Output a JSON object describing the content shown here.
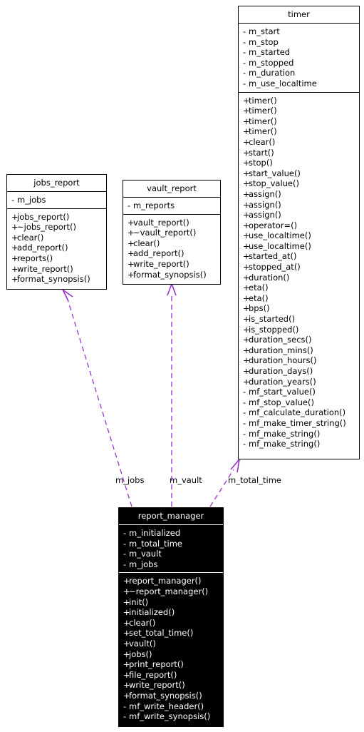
{
  "diagram": {
    "type": "uml-class-diagram",
    "background_color": "#ffffff",
    "edge_color": "#9a32cd",
    "classes": [
      {
        "id": "timer",
        "name": "timer",
        "style": "light",
        "attributes": [
          {
            "visibility": "-",
            "name": "m_start"
          },
          {
            "visibility": "-",
            "name": "m_stop"
          },
          {
            "visibility": "-",
            "name": "m_started"
          },
          {
            "visibility": "-",
            "name": "m_stopped"
          },
          {
            "visibility": "-",
            "name": "m_duration"
          },
          {
            "visibility": "-",
            "name": "m_use_localtime"
          }
        ],
        "operations": [
          {
            "visibility": "+",
            "name": "timer()"
          },
          {
            "visibility": "+",
            "name": "timer()"
          },
          {
            "visibility": "+",
            "name": "timer()"
          },
          {
            "visibility": "+",
            "name": "timer()"
          },
          {
            "visibility": "+",
            "name": "clear()"
          },
          {
            "visibility": "+",
            "name": "start()"
          },
          {
            "visibility": "+",
            "name": "stop()"
          },
          {
            "visibility": "+",
            "name": "start_value()"
          },
          {
            "visibility": "+",
            "name": "stop_value()"
          },
          {
            "visibility": "+",
            "name": "assign()"
          },
          {
            "visibility": "+",
            "name": "assign()"
          },
          {
            "visibility": "+",
            "name": "assign()"
          },
          {
            "visibility": "+",
            "name": "operator=()"
          },
          {
            "visibility": "+",
            "name": "use_localtime()"
          },
          {
            "visibility": "+",
            "name": "use_localtime()"
          },
          {
            "visibility": "+",
            "name": "started_at()"
          },
          {
            "visibility": "+",
            "name": "stopped_at()"
          },
          {
            "visibility": "+",
            "name": "duration()"
          },
          {
            "visibility": "+",
            "name": "eta()"
          },
          {
            "visibility": "+",
            "name": "eta()"
          },
          {
            "visibility": "+",
            "name": "bps()"
          },
          {
            "visibility": "+",
            "name": "is_started()"
          },
          {
            "visibility": "+",
            "name": "is_stopped()"
          },
          {
            "visibility": "+",
            "name": "duration_secs()"
          },
          {
            "visibility": "+",
            "name": "duration_mins()"
          },
          {
            "visibility": "+",
            "name": "duration_hours()"
          },
          {
            "visibility": "+",
            "name": "duration_days()"
          },
          {
            "visibility": "+",
            "name": "duration_years()"
          },
          {
            "visibility": "-",
            "name": "mf_start_value()"
          },
          {
            "visibility": "-",
            "name": "mf_stop_value()"
          },
          {
            "visibility": "-",
            "name": "mf_calculate_duration()"
          },
          {
            "visibility": "-",
            "name": "mf_make_timer_string()"
          },
          {
            "visibility": "-",
            "name": "mf_make_string()"
          },
          {
            "visibility": "-",
            "name": "mf_make_string()"
          }
        ]
      },
      {
        "id": "jobs_report",
        "name": "jobs_report",
        "style": "light",
        "attributes": [
          {
            "visibility": "-",
            "name": "m_jobs"
          }
        ],
        "operations": [
          {
            "visibility": "+",
            "name": "jobs_report()"
          },
          {
            "visibility": "+",
            "name": "~jobs_report()"
          },
          {
            "visibility": "+",
            "name": "clear()"
          },
          {
            "visibility": "+",
            "name": "add_report()"
          },
          {
            "visibility": "+",
            "name": "reports()"
          },
          {
            "visibility": "+",
            "name": "write_report()"
          },
          {
            "visibility": "+",
            "name": "format_synopsis()"
          }
        ]
      },
      {
        "id": "vault_report",
        "name": "vault_report",
        "style": "light",
        "attributes": [
          {
            "visibility": "-",
            "name": "m_reports"
          }
        ],
        "operations": [
          {
            "visibility": "+",
            "name": "vault_report()"
          },
          {
            "visibility": "+",
            "name": "~vault_report()"
          },
          {
            "visibility": "+",
            "name": "clear()"
          },
          {
            "visibility": "+",
            "name": "add_report()"
          },
          {
            "visibility": "+",
            "name": "write_report()"
          },
          {
            "visibility": "+",
            "name": "format_synopsis()"
          }
        ]
      },
      {
        "id": "report_manager",
        "name": "report_manager",
        "style": "dark",
        "attributes": [
          {
            "visibility": "-",
            "name": "m_initialized"
          },
          {
            "visibility": "-",
            "name": "m_total_time"
          },
          {
            "visibility": "-",
            "name": "m_vault"
          },
          {
            "visibility": "-",
            "name": "m_jobs"
          }
        ],
        "operations": [
          {
            "visibility": "+",
            "name": "report_manager()"
          },
          {
            "visibility": "+",
            "name": "~report_manager()"
          },
          {
            "visibility": "+",
            "name": "init()"
          },
          {
            "visibility": "+",
            "name": "initialized()"
          },
          {
            "visibility": "+",
            "name": "clear()"
          },
          {
            "visibility": "+",
            "name": "set_total_time()"
          },
          {
            "visibility": "+",
            "name": "vault()"
          },
          {
            "visibility": "+",
            "name": "jobs()"
          },
          {
            "visibility": "+",
            "name": "print_report()"
          },
          {
            "visibility": "+",
            "name": "file_report()"
          },
          {
            "visibility": "+",
            "name": "write_report()"
          },
          {
            "visibility": "+",
            "name": "format_synopsis()"
          },
          {
            "visibility": "-",
            "name": "mf_write_header()"
          },
          {
            "visibility": "-",
            "name": "mf_write_synopsis()"
          }
        ]
      }
    ],
    "edges": [
      {
        "id": "edge-m-jobs",
        "label": "m_jobs",
        "from": "report_manager",
        "to": "jobs_report",
        "style": "dashed",
        "arrow": "open"
      },
      {
        "id": "edge-m-vault",
        "label": "m_vault",
        "from": "report_manager",
        "to": "vault_report",
        "style": "dashed",
        "arrow": "open"
      },
      {
        "id": "edge-m-total-time",
        "label": "m_total_time",
        "from": "report_manager",
        "to": "timer",
        "style": "dashed",
        "arrow": "open"
      }
    ]
  }
}
